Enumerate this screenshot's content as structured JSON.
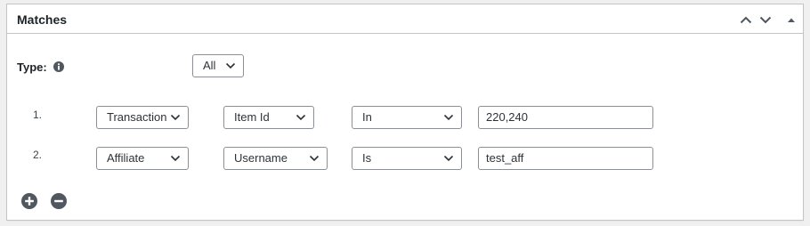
{
  "panel": {
    "title": "Matches",
    "controls": {
      "move_up_icon": "chevron-up-icon",
      "move_down_icon": "chevron-down-icon",
      "toggle_icon": "triangle-up-icon"
    }
  },
  "type": {
    "label": "Type:",
    "info_icon": "info-icon",
    "selected": "All"
  },
  "rules": [
    {
      "number": "1.",
      "object": "Transaction",
      "field": "Item Id",
      "operator": "In",
      "value": "220,240"
    },
    {
      "number": "2.",
      "object": "Affiliate",
      "field": "Username",
      "operator": "Is",
      "value": "test_aff"
    }
  ],
  "actions": {
    "add_icon": "plus-circle-icon",
    "remove_icon": "minus-circle-icon"
  },
  "colors": {
    "border": "#c3c4c7",
    "input_border": "#8c8f94",
    "icon_dark": "#50575e",
    "background": "#f0f0f1"
  }
}
